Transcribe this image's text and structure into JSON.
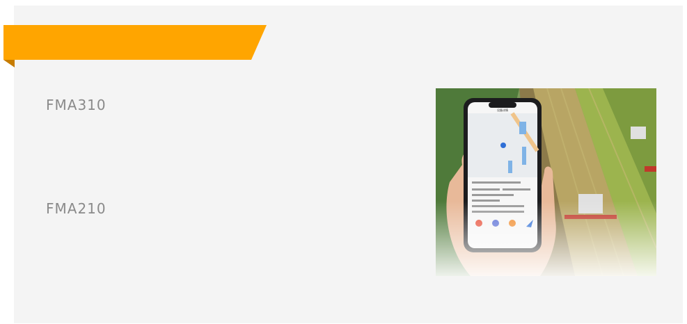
{
  "banner": {
    "title": "",
    "color": "#ffa500",
    "fold_color": "#c77c00"
  },
  "products": [
    {
      "model": "FMA310"
    },
    {
      "model": "FMA210"
    }
  ],
  "photo": {
    "description_icon": "phone-app-field-icon",
    "app_title": "设备详情"
  }
}
